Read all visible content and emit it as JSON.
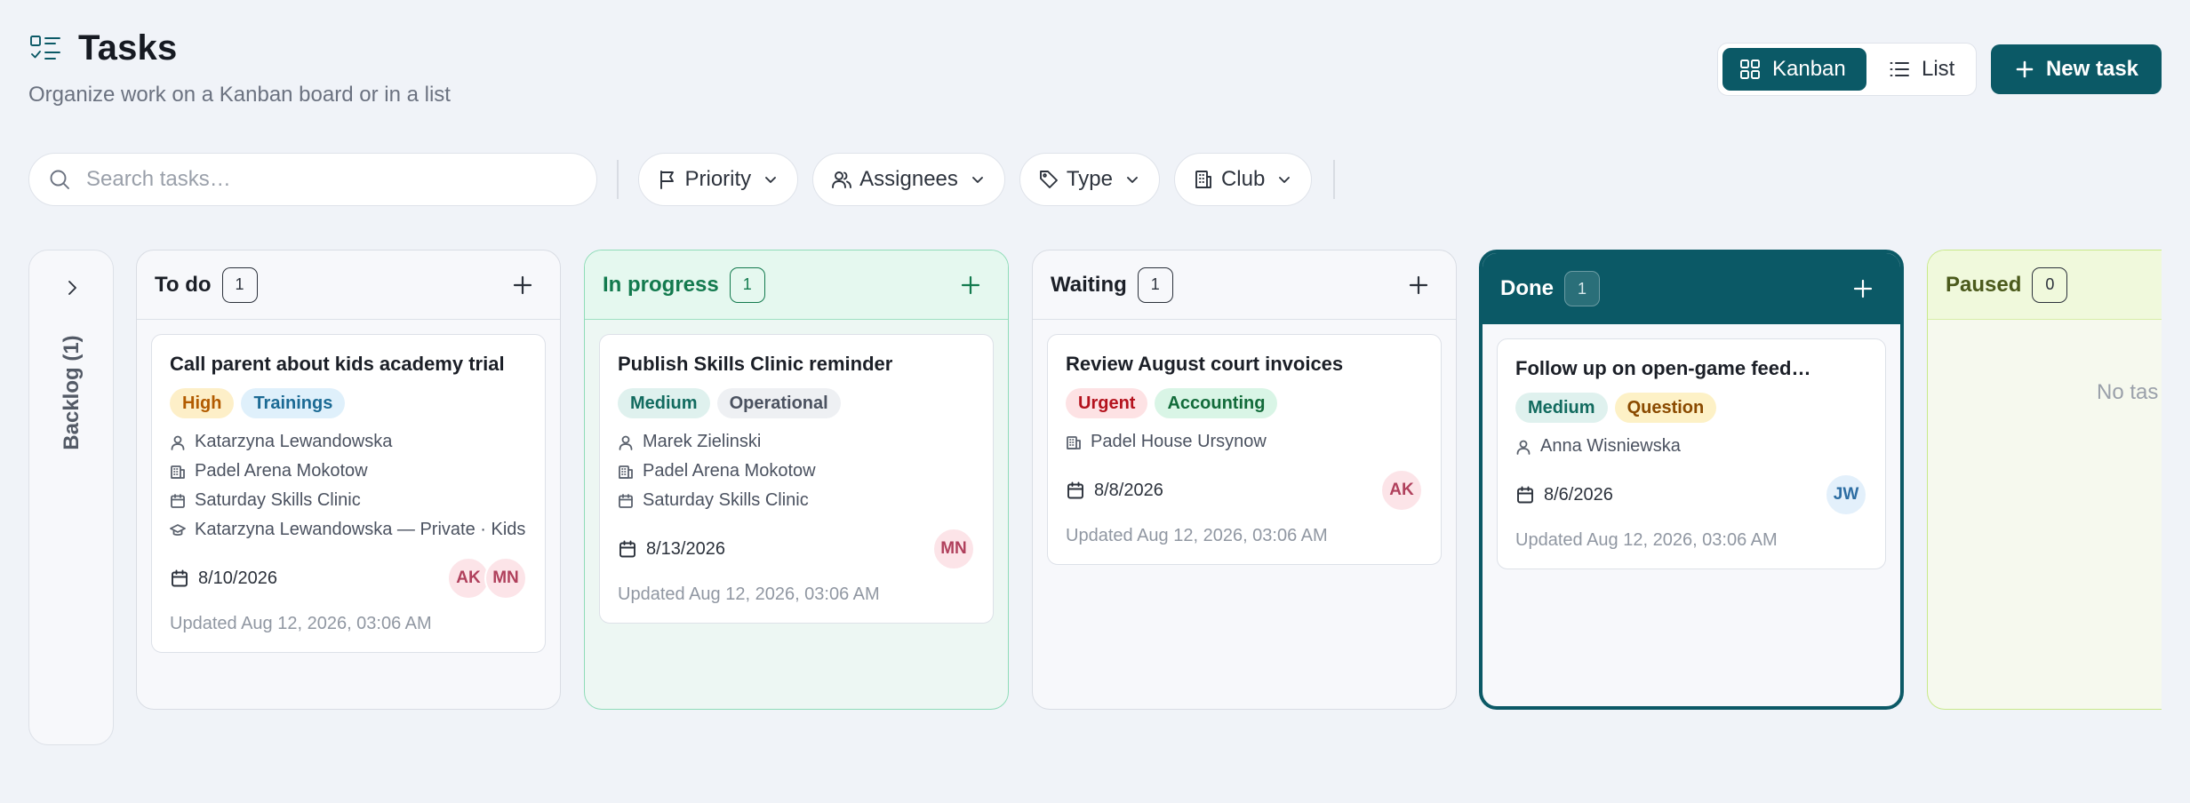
{
  "header": {
    "title": "Tasks",
    "subtitle": "Organize work on a Kanban board or in a list",
    "icon": "task-list-icon"
  },
  "view_toggle": {
    "kanban": "Kanban",
    "list": "List",
    "active": "Kanban"
  },
  "new_task_label": "New task",
  "filters": {
    "search_placeholder": "Search tasks…",
    "priority": "Priority",
    "assignees": "Assignees",
    "type": "Type",
    "club": "Club"
  },
  "backlog": {
    "label": "Backlog (1)"
  },
  "colors": {
    "brand": "#0b5966",
    "in_progress": "#137a4e",
    "paused": "#c8e98a"
  },
  "columns": {
    "todo": {
      "title": "To do",
      "count": "1",
      "card": {
        "title": "Call parent about kids academy trial",
        "tags": [
          {
            "label": "High",
            "bg": "#fdefc8",
            "fg": "#b25b00"
          },
          {
            "label": "Trainings",
            "bg": "#dff0fb",
            "fg": "#1b6a94"
          }
        ],
        "assignee": "Katarzyna Lewandowska",
        "club": "Padel Arena Mokotow",
        "event": "Saturday Skills Clinic",
        "training": "Katarzyna Lewandowska — Private · Kids",
        "date": "8/10/2026",
        "avatars": [
          "AK",
          "MN"
        ],
        "updated": "Updated Aug 12, 2026, 03:06 AM"
      }
    },
    "in_progress": {
      "title": "In progress",
      "count": "1",
      "card": {
        "title": "Publish Skills Clinic reminder",
        "tags": [
          {
            "label": "Medium",
            "bg": "#dff1ee",
            "fg": "#126b5f"
          },
          {
            "label": "Operational",
            "bg": "#eef0f3",
            "fg": "#4b5260"
          }
        ],
        "assignee": "Marek Zielinski",
        "club": "Padel Arena Mokotow",
        "event": "Saturday Skills Clinic",
        "date": "8/13/2026",
        "avatars": [
          "MN"
        ],
        "updated": "Updated Aug 12, 2026, 03:06 AM"
      }
    },
    "waiting": {
      "title": "Waiting",
      "count": "1",
      "card": {
        "title": "Review August court invoices",
        "tags": [
          {
            "label": "Urgent",
            "bg": "#fde2e4",
            "fg": "#b4121d"
          },
          {
            "label": "Accounting",
            "bg": "#d9f5e6",
            "fg": "#126b3a"
          }
        ],
        "club": "Padel House Ursynow",
        "date": "8/8/2026",
        "avatars": [
          "AK"
        ],
        "updated": "Updated Aug 12, 2026, 03:06 AM"
      }
    },
    "done": {
      "title": "Done",
      "count": "1",
      "card": {
        "title": "Follow up on open-game feed…",
        "tags": [
          {
            "label": "Medium",
            "bg": "#dff1ee",
            "fg": "#126b5f"
          },
          {
            "label": "Question",
            "bg": "#fdf1c6",
            "fg": "#8a4a00"
          }
        ],
        "assignee": "Anna Wisniewska",
        "date": "8/6/2026",
        "avatars": [
          "JW"
        ],
        "updated": "Updated Aug 12, 2026, 03:06 AM"
      }
    },
    "paused": {
      "title": "Paused",
      "count": "0",
      "empty_text": "No tas"
    }
  },
  "avatar_colors": {
    "AK": {
      "bg": "#fce4e8",
      "fg": "#b0405c"
    },
    "MN": {
      "bg": "#fce4e8",
      "fg": "#b0405c"
    },
    "JW": {
      "bg": "#e3f0fb",
      "fg": "#2e6ea3"
    }
  }
}
